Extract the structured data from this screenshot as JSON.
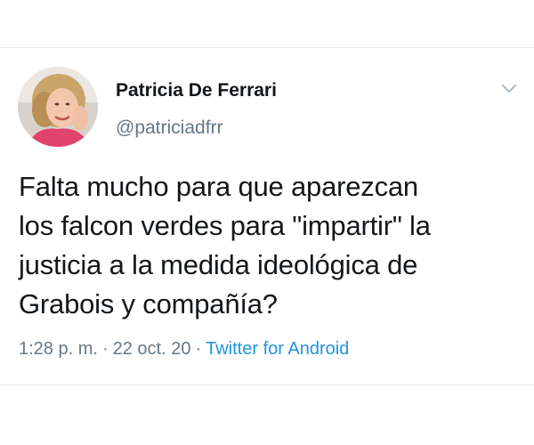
{
  "tweet": {
    "author": {
      "display_name": "Patricia De Ferrari",
      "handle": "@patriciadfrr",
      "avatar_icon": "profile-photo"
    },
    "menu_icon": "chevron-down-icon",
    "text": "Falta mucho para que aparezcan\nlos falcon verdes para \"impartir\" la\njusticia a la medida ideológica de\nGrabois y compañía?",
    "time": "1:28 p. m.",
    "separator": "·",
    "date": "22 oct. 20",
    "source": "Twitter for Android"
  },
  "colors": {
    "text_primary": "#14171a",
    "text_secondary": "#657786",
    "link": "#1b95e0",
    "divider": "#e6ecf0"
  }
}
